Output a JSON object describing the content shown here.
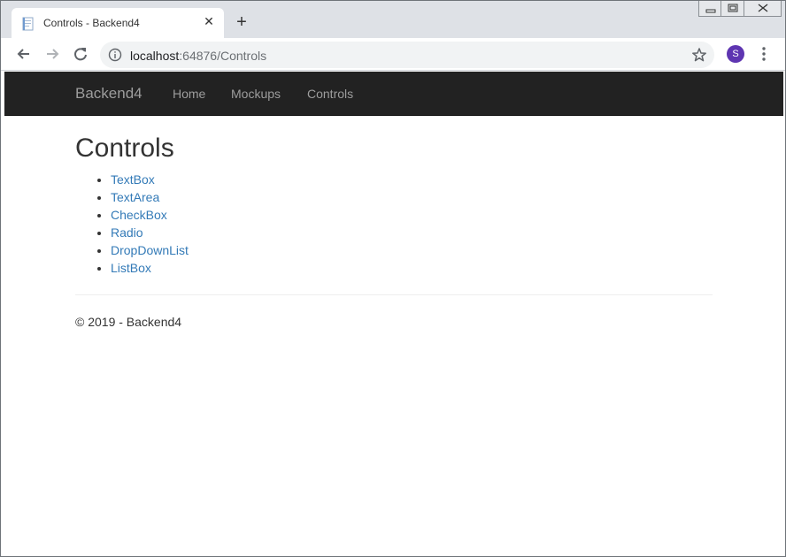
{
  "browser": {
    "tab": {
      "title": "Controls - Backend4"
    },
    "omnibox": {
      "host": "localhost",
      "rest": ":64876/Controls"
    },
    "profile": {
      "initial": "S",
      "color": "#5e35b1"
    }
  },
  "navbar": {
    "brand": "Backend4",
    "links": [
      "Home",
      "Mockups",
      "Controls"
    ]
  },
  "main": {
    "title": "Controls",
    "items": [
      "TextBox",
      "TextArea",
      "CheckBox",
      "Radio",
      "DropDownList",
      "ListBox"
    ]
  },
  "footer": {
    "text": "© 2019 - Backend4"
  },
  "colors": {
    "navbar_bg": "#222222",
    "link": "#337ab7",
    "tabstrip": "#dee1e6"
  }
}
